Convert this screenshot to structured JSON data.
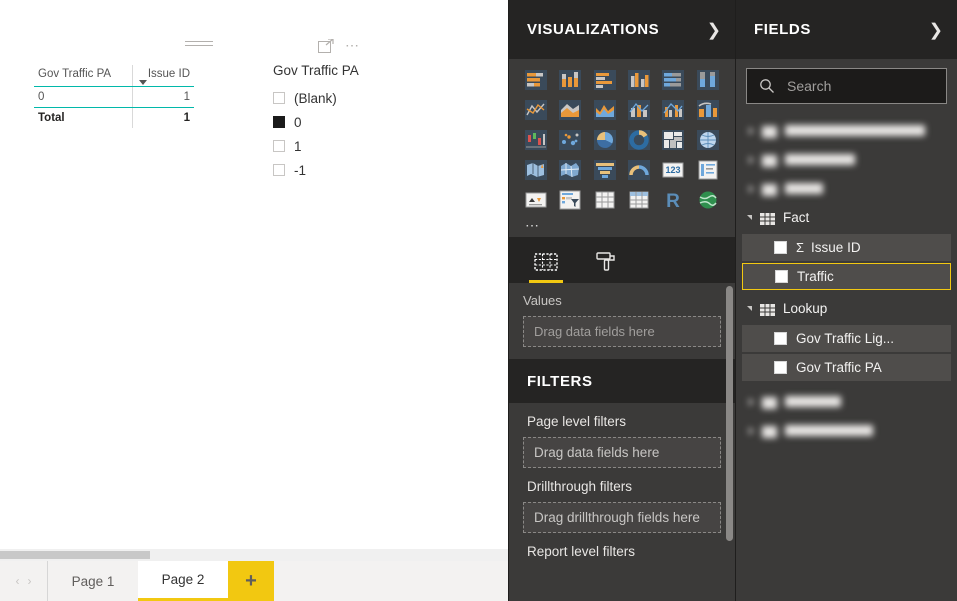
{
  "report": {
    "visual": {
      "header_icons": [
        "drag-handle-icon",
        "focus-mode-icon",
        "more-options-icon"
      ],
      "table": {
        "columns": [
          "Gov Traffic PA",
          "Issue ID"
        ],
        "rows": [
          [
            "0",
            "1"
          ]
        ],
        "total_row": [
          "Total",
          "1"
        ],
        "sort_column": "Issue ID",
        "accent_color": "#01b8aa"
      },
      "slicer": {
        "title": "Gov Traffic PA",
        "items": [
          {
            "label": "(Blank)",
            "checked": false
          },
          {
            "label": "0",
            "checked": true
          },
          {
            "label": "1",
            "checked": false
          },
          {
            "label": "-1",
            "checked": false
          }
        ]
      }
    },
    "tabs": {
      "prev_label": "‹",
      "next_label": "›",
      "pages": [
        {
          "label": "Page 1",
          "active": false
        },
        {
          "label": "Page 2",
          "active": true
        }
      ],
      "add_label": "+",
      "active_underline_color": "#f2c811"
    }
  },
  "visualizations": {
    "title": "VISUALIZATIONS",
    "collapse_icon": "chevron-right-icon",
    "icons": [
      "stacked-bar-chart-icon",
      "stacked-column-chart-icon",
      "clustered-bar-chart-icon",
      "clustered-column-chart-icon",
      "100-stacked-bar-chart-icon",
      "100-stacked-column-chart-icon",
      "line-chart-icon",
      "area-chart-icon",
      "stacked-area-chart-icon",
      "line-and-stacked-column-chart-icon",
      "line-and-clustered-column-chart-icon",
      "ribbon-chart-icon",
      "waterfall-chart-icon",
      "scatter-chart-icon",
      "pie-chart-icon",
      "donut-chart-icon",
      "treemap-icon",
      "map-icon",
      "filled-map-icon",
      "shape-map-icon",
      "funnel-chart-icon",
      "gauge-chart-icon",
      "card-icon",
      "multi-row-card-icon",
      "kpi-icon",
      "slicer-icon",
      "table-icon",
      "matrix-icon",
      "r-script-visual-icon",
      "arcgis-map-icon"
    ],
    "more_icon": "more-visuals-icon",
    "tabs": [
      {
        "name": "fields-tab",
        "icon": "fields-well-icon",
        "active": true
      },
      {
        "name": "format-tab",
        "icon": "paint-roller-icon",
        "active": false
      }
    ],
    "wells": {
      "values_label": "Values",
      "values_placeholder": "Drag data fields here"
    }
  },
  "filters": {
    "title": "FILTERS",
    "groups": [
      {
        "label": "Page level filters",
        "placeholder": "Drag data fields here"
      },
      {
        "label": "Drillthrough filters",
        "placeholder": "Drag drillthrough fields here"
      },
      {
        "label": "Report level filters",
        "placeholder": null
      }
    ]
  },
  "fields": {
    "title": "FIELDS",
    "collapse_icon": "chevron-right-icon",
    "search": {
      "placeholder": "Search",
      "value": "",
      "icon": "search-icon"
    },
    "tables": [
      {
        "name": "",
        "blurred": true,
        "expanded": false,
        "blur_width": 140
      },
      {
        "name": "",
        "blurred": true,
        "expanded": false,
        "blur_width": 70
      },
      {
        "name": "",
        "blurred": true,
        "expanded": false,
        "blur_width": 38
      },
      {
        "name": "Fact",
        "blurred": false,
        "expanded": true,
        "items": [
          {
            "label": "Issue ID",
            "aggregate": "Σ",
            "selected": false
          },
          {
            "label": "Traffic",
            "aggregate": null,
            "selected": true
          }
        ]
      },
      {
        "name": "Lookup",
        "blurred": false,
        "expanded": true,
        "items": [
          {
            "label": "Gov Traffic Lig...",
            "aggregate": null,
            "selected": false
          },
          {
            "label": "Gov Traffic PA",
            "aggregate": null,
            "selected": false
          }
        ]
      },
      {
        "name": "",
        "blurred": true,
        "expanded": false,
        "blur_width": 56
      },
      {
        "name": "",
        "blurred": true,
        "expanded": false,
        "blur_width": 88
      }
    ],
    "selection_color": "#f2c811"
  }
}
